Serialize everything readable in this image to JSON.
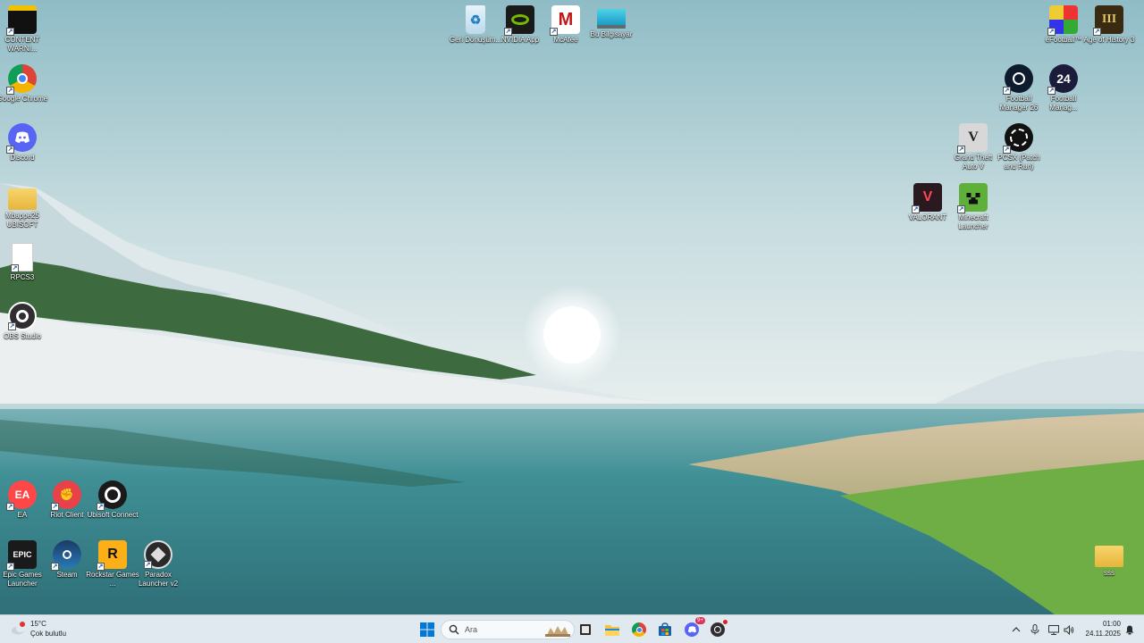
{
  "desktop": {
    "icons_left": [
      {
        "label": "CONTENT WARNI...",
        "icon": "content-warning-icon"
      },
      {
        "label": "Google Chrome",
        "icon": "chrome-icon"
      },
      {
        "label": "Discord",
        "icon": "discord-icon"
      },
      {
        "label": "Mbappe25 UBISOFT",
        "icon": "folder-icon"
      },
      {
        "label": "RPCS3",
        "icon": "file-icon"
      },
      {
        "label": "OBS Studio",
        "icon": "obs-icon"
      }
    ],
    "icons_top": [
      {
        "label": "Geri Dönüşüm...",
        "icon": "recycle-bin-icon"
      },
      {
        "label": "NVIDIA App",
        "icon": "nvidia-icon"
      },
      {
        "label": "McAfee",
        "icon": "mcafee-icon"
      },
      {
        "label": "Bu Bilgisayar",
        "icon": "this-pc-icon"
      }
    ],
    "icons_right": [
      {
        "label": "eFootball™",
        "icon": "efootball-icon"
      },
      {
        "label": "Age of History 3",
        "icon": "age-of-history-icon"
      },
      {
        "label": "Football Manager 26",
        "icon": "fm26-icon"
      },
      {
        "label": "Football Manag...",
        "icon": "fm24-icon"
      },
      {
        "label": "Grand Theft Auto V",
        "icon": "gta-icon"
      },
      {
        "label": "PCSX (Patch and Run)",
        "icon": "pcsx-icon"
      },
      {
        "label": "VALORANT",
        "icon": "valorant-icon"
      },
      {
        "label": "Minecraft Launcher",
        "icon": "minecraft-icon"
      }
    ],
    "icons_bottom": [
      {
        "label": "EA",
        "icon": "ea-icon"
      },
      {
        "label": "Riot Client",
        "icon": "riot-icon"
      },
      {
        "label": "Ubisoft Connect",
        "icon": "ubisoft-icon"
      },
      {
        "label": "Epic Games Launcher",
        "icon": "epic-icon"
      },
      {
        "label": "Steam",
        "icon": "steam-icon"
      },
      {
        "label": "Rockstar Games ...",
        "icon": "rockstar-icon"
      },
      {
        "label": "Paradox Launcher v2",
        "icon": "paradox-icon"
      }
    ],
    "icon_bottom_right": {
      "label": "sss",
      "icon": "folder-icon"
    }
  },
  "taskbar": {
    "weather": {
      "temp": "15°C",
      "condition": "Çok bulutlu"
    },
    "search_placeholder": "Ara",
    "pinned": [
      "start-icon",
      "task-view-icon",
      "file-explorer-icon",
      "chrome-icon",
      "ms-store-icon",
      "discord-icon",
      "obs-icon"
    ],
    "discord_badge": "9+",
    "clock": {
      "time": "01:00",
      "date": "24.11.2025"
    }
  },
  "colors": {
    "taskbar_bg": "#dfe9ef",
    "accent": "#0078d4"
  }
}
